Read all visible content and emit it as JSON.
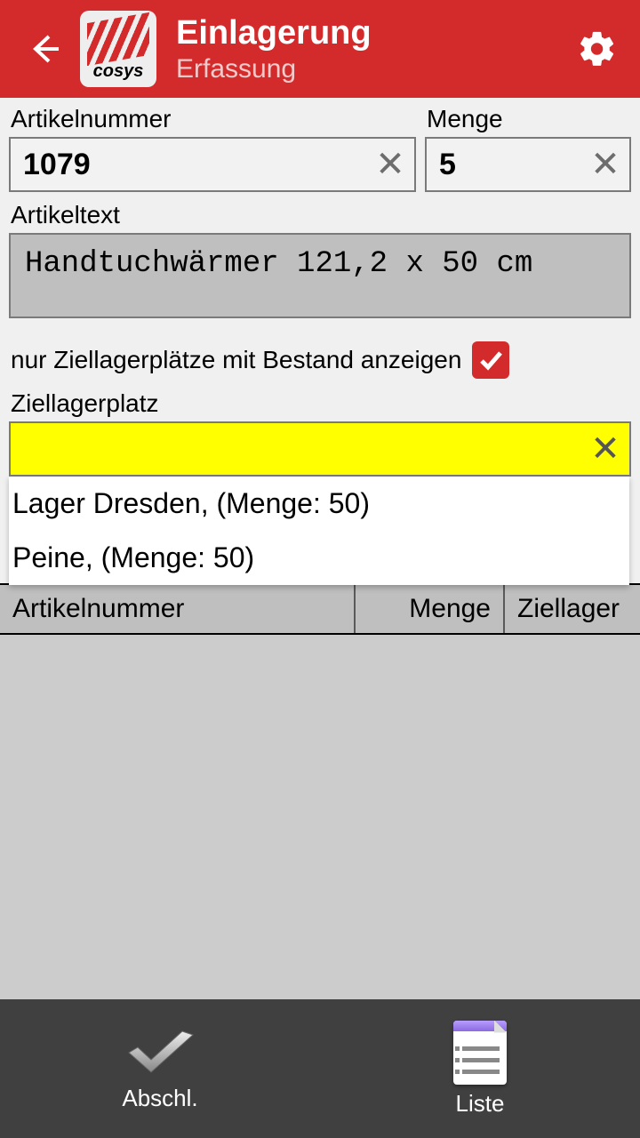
{
  "header": {
    "title": "Einlagerung",
    "subtitle": "Erfassung",
    "logo_text": "cosys"
  },
  "form": {
    "artnr_label": "Artikelnummer",
    "artnr_value": "1079",
    "menge_label": "Menge",
    "menge_value": "5",
    "arttext_label": "Artikeltext",
    "arttext_value": "Handtuchwärmer 121,2 x 50 cm",
    "check_label": "nur Ziellagerplätze mit Bestand anzeigen",
    "checked": true,
    "ziel_label": "Ziellagerplatz",
    "ziel_value": "",
    "dropdown": [
      "Lager Dresden, (Menge: 50)",
      "Peine, (Menge: 50)"
    ]
  },
  "table": {
    "col1": "Artikelnummer",
    "col2": "Menge",
    "col3": "Ziellager"
  },
  "bottom": {
    "btn1": "Abschl.",
    "btn2": "Liste"
  }
}
